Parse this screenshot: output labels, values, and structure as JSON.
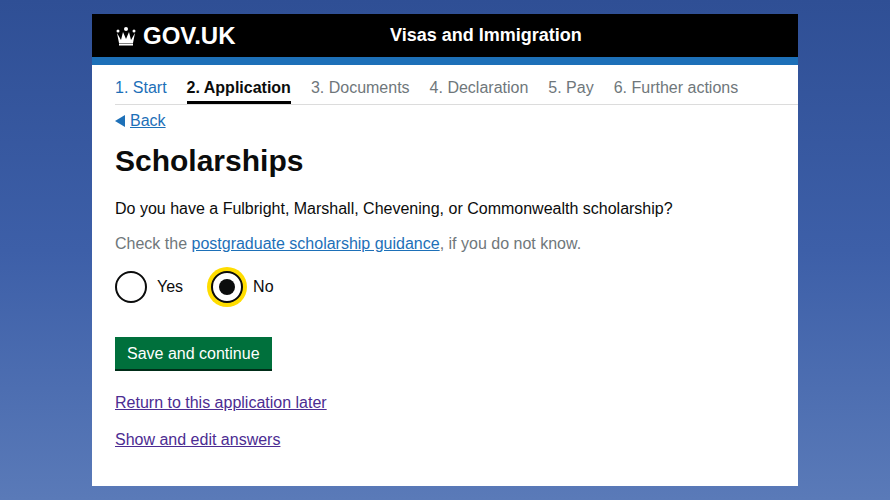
{
  "header": {
    "logo": "GOV.UK",
    "service": "Visas and Immigration"
  },
  "steps": [
    {
      "label": "1. Start",
      "selected": false,
      "completed": true
    },
    {
      "label": "2. Application",
      "selected": true,
      "completed": false
    },
    {
      "label": "3. Documents",
      "selected": false,
      "completed": false
    },
    {
      "label": "4. Declaration",
      "selected": false,
      "completed": false
    },
    {
      "label": "5. Pay",
      "selected": false,
      "completed": false
    },
    {
      "label": "6. Further actions",
      "selected": false,
      "completed": false
    }
  ],
  "back_link": "Back",
  "page": {
    "heading": "Scholarships",
    "question": "Do you have a Fulbright, Marshall, Chevening, or Commonwealth scholarship?",
    "hint": {
      "before": "Check the ",
      "link": "postgraduate scholarship guidance",
      "after": ", if you do not know."
    }
  },
  "radios": [
    {
      "label": "Yes",
      "selected": false,
      "focused": false
    },
    {
      "label": "No",
      "selected": true,
      "focused": true
    }
  ],
  "button": "Save and continue",
  "links": [
    "Return to this application later",
    "Show and edit answers"
  ]
}
